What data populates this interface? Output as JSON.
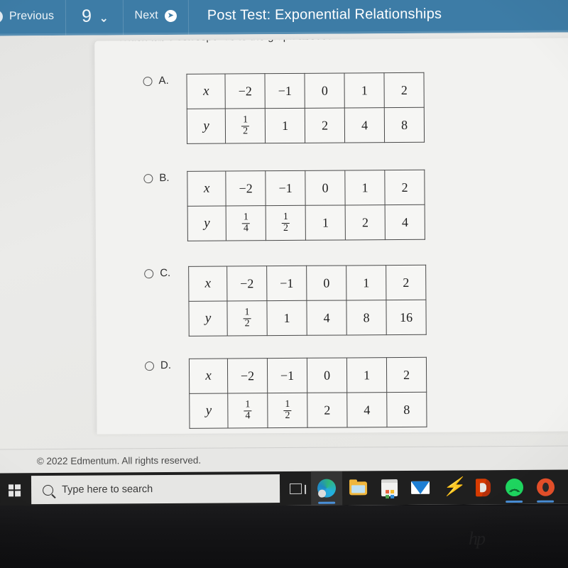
{
  "topbar": {
    "back_icon": "circle-back-arrow-icon",
    "previous_label": "Previous",
    "question_number": "9",
    "caret": "⌄",
    "next_label": "Next",
    "next_icon": "circle-right-arrow-icon",
    "title": "Post Test: Exponential Relationships",
    "color": "#3d7ca6"
  },
  "question": {
    "prompt": "Which table corresponds to the graph above?"
  },
  "table_header": {
    "x_label": "x",
    "y_label": "y"
  },
  "options": [
    {
      "id": "A",
      "letter": "A.",
      "selected": false,
      "x_values": [
        "−2",
        "−1",
        "0",
        "1",
        "2"
      ],
      "y_values": [
        {
          "type": "fraction",
          "num": "1",
          "den": "2"
        },
        {
          "type": "plain",
          "text": "1"
        },
        {
          "type": "plain",
          "text": "2"
        },
        {
          "type": "plain",
          "text": "4"
        },
        {
          "type": "plain",
          "text": "8"
        }
      ]
    },
    {
      "id": "B",
      "letter": "B.",
      "selected": false,
      "x_values": [
        "−2",
        "−1",
        "0",
        "1",
        "2"
      ],
      "y_values": [
        {
          "type": "fraction",
          "num": "1",
          "den": "4"
        },
        {
          "type": "fraction",
          "num": "1",
          "den": "2"
        },
        {
          "type": "plain",
          "text": "1"
        },
        {
          "type": "plain",
          "text": "2"
        },
        {
          "type": "plain",
          "text": "4"
        }
      ]
    },
    {
      "id": "C",
      "letter": "C.",
      "selected": false,
      "x_values": [
        "−2",
        "−1",
        "0",
        "1",
        "2"
      ],
      "y_values": [
        {
          "type": "fraction",
          "num": "1",
          "den": "2"
        },
        {
          "type": "plain",
          "text": "1"
        },
        {
          "type": "plain",
          "text": "4"
        },
        {
          "type": "plain",
          "text": "8"
        },
        {
          "type": "plain",
          "text": "16"
        }
      ]
    },
    {
      "id": "D",
      "letter": "D.",
      "selected": false,
      "x_values": [
        "−2",
        "−1",
        "0",
        "1",
        "2"
      ],
      "y_values": [
        {
          "type": "fraction",
          "num": "1",
          "den": "4"
        },
        {
          "type": "fraction",
          "num": "1",
          "den": "2"
        },
        {
          "type": "plain",
          "text": "2"
        },
        {
          "type": "plain",
          "text": "4"
        },
        {
          "type": "plain",
          "text": "8"
        }
      ]
    }
  ],
  "footer": {
    "copyright": "© 2022 Edmentum. All rights reserved."
  },
  "taskbar": {
    "start_icon": "windows-logo-icon",
    "search_placeholder": "Type here to search",
    "search_value": "",
    "search_icon": "search-icon",
    "items": [
      {
        "name": "task-view-icon",
        "glyph": "g-taskview",
        "active": false,
        "running": false
      },
      {
        "name": "microsoft-edge-icon",
        "glyph": "g-edge",
        "active": true,
        "running": true
      },
      {
        "name": "file-explorer-icon",
        "glyph": "g-explorer",
        "active": false,
        "running": false
      },
      {
        "name": "microsoft-store-icon",
        "glyph": "g-store",
        "active": false,
        "running": false
      },
      {
        "name": "mail-icon",
        "glyph": "g-mail",
        "active": false,
        "running": false
      },
      {
        "name": "lightning-bolt-icon",
        "glyph": "g-bolt",
        "active": false,
        "running": false
      },
      {
        "name": "microsoft-office-icon",
        "glyph": "g-office",
        "active": false,
        "running": false
      },
      {
        "name": "spotify-icon",
        "glyph": "g-spotify",
        "active": false,
        "running": true
      },
      {
        "name": "opera-gx-icon",
        "glyph": "g-opera",
        "active": false,
        "running": true
      },
      {
        "name": "partial-app-icon",
        "glyph": "g-partial",
        "active": false,
        "running": false
      }
    ]
  },
  "device": {
    "brand_logo": "hp"
  }
}
